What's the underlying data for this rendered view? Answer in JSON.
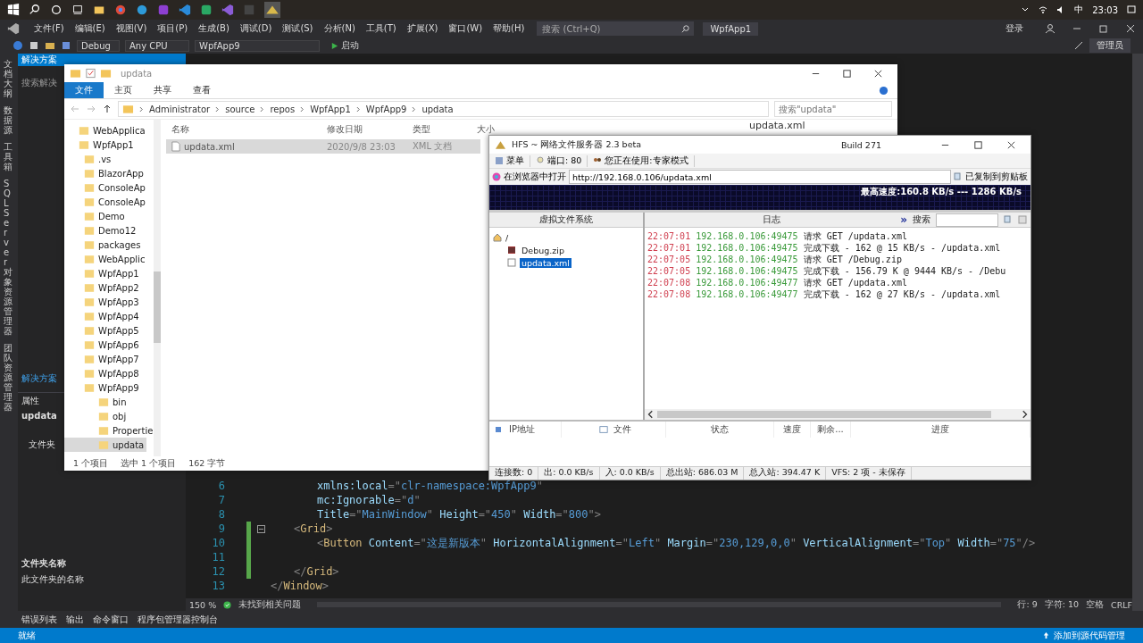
{
  "taskbar": {
    "ime": "中",
    "clock": "23:03"
  },
  "vs": {
    "menu": [
      "文件(F)",
      "编辑(E)",
      "视图(V)",
      "项目(P)",
      "生成(B)",
      "调试(D)",
      "测试(S)",
      "分析(N)",
      "工具(T)",
      "扩展(X)",
      "窗口(W)",
      "帮助(H)"
    ],
    "search": {
      "placeholder": "搜索 (Ctrl+Q)"
    },
    "solution_name": "WpfApp1",
    "login": "登录",
    "admin_badge": "管理员",
    "toolbar": {
      "configuration": "Debug",
      "platform": "Any CPU",
      "project": "WpfApp9",
      "start": "启动"
    },
    "side_tabs": [
      "文档大纲",
      "数据源",
      "工具箱",
      "SQL Server 对象资源管理器",
      "团队资源管理器"
    ],
    "solution_explorer": {
      "title": "解决方案",
      "search": "搜索解决",
      "footer_link": "解决方案"
    },
    "properties": {
      "title": "属性",
      "object": "updata",
      "row": "文件夹",
      "desc_title": "文件夹名称",
      "desc_text": "此文件夹的名称"
    },
    "code_lines": [
      {
        "number": "6",
        "changed": false,
        "foldable": false,
        "kind": "attribute",
        "tokens": [
          {
            "kind": "attr",
            "text": "xmlns:local"
          },
          {
            "kind": "punct",
            "text": "=\""
          },
          {
            "kind": "value",
            "text": "clr-namespace:WpfApp9"
          },
          {
            "kind": "punct",
            "text": "\""
          }
        ]
      },
      {
        "number": "7",
        "changed": false,
        "foldable": false,
        "kind": "attribute",
        "tokens": [
          {
            "kind": "attr",
            "text": "mc:Ignorable"
          },
          {
            "kind": "punct",
            "text": "=\""
          },
          {
            "kind": "value",
            "text": "d"
          },
          {
            "kind": "punct",
            "text": "\""
          }
        ]
      },
      {
        "number": "8",
        "changed": false,
        "foldable": false,
        "kind": "attribute",
        "tokens": [
          {
            "kind": "attr",
            "text": "Title"
          },
          {
            "kind": "punct",
            "text": "=\""
          },
          {
            "kind": "value",
            "text": "MainWindow"
          },
          {
            "kind": "punct",
            "text": "\" "
          },
          {
            "kind": "attr",
            "text": "Height"
          },
          {
            "kind": "punct",
            "text": "=\""
          },
          {
            "kind": "value",
            "text": "450"
          },
          {
            "kind": "punct",
            "text": "\" "
          },
          {
            "kind": "attr",
            "text": "Width"
          },
          {
            "kind": "punct",
            "text": "=\""
          },
          {
            "kind": "value",
            "text": "800"
          },
          {
            "kind": "punct",
            "text": "\">"
          }
        ]
      },
      {
        "number": "9",
        "changed": true,
        "foldable": true,
        "kind": "block",
        "tokens": [
          {
            "kind": "punct",
            "text": "<"
          },
          {
            "kind": "element",
            "text": "Grid"
          },
          {
            "kind": "punct",
            "text": ">"
          }
        ]
      },
      {
        "number": "10",
        "changed": true,
        "foldable": false,
        "kind": "nested",
        "tokens": [
          {
            "kind": "punct",
            "text": "<"
          },
          {
            "kind": "element",
            "text": "Button"
          },
          {
            "kind": "attr",
            "text": " Content"
          },
          {
            "kind": "punct",
            "text": "=\""
          },
          {
            "kind": "value",
            "text": "这是新版本"
          },
          {
            "kind": "punct",
            "text": "\" "
          },
          {
            "kind": "attr",
            "text": "HorizontalAlignment"
          },
          {
            "kind": "punct",
            "text": "=\""
          },
          {
            "kind": "value",
            "text": "Left"
          },
          {
            "kind": "punct",
            "text": "\" "
          },
          {
            "kind": "attr",
            "text": "Margin"
          },
          {
            "kind": "punct",
            "text": "=\""
          },
          {
            "kind": "value",
            "text": "230,129,0,0"
          },
          {
            "kind": "punct",
            "text": "\" "
          },
          {
            "kind": "attr",
            "text": "VerticalAlignment"
          },
          {
            "kind": "punct",
            "text": "=\""
          },
          {
            "kind": "value",
            "text": "Top"
          },
          {
            "kind": "punct",
            "text": "\" "
          },
          {
            "kind": "attr",
            "text": "Width"
          },
          {
            "kind": "punct",
            "text": "=\""
          },
          {
            "kind": "value",
            "text": "75"
          },
          {
            "kind": "punct",
            "text": "\"/>"
          }
        ]
      },
      {
        "number": "11",
        "changed": true,
        "foldable": false
      },
      {
        "number": "12",
        "changed": true,
        "foldable": false,
        "kind": "block",
        "tokens": [
          {
            "kind": "punct",
            "text": "</"
          },
          {
            "kind": "element",
            "text": "Grid"
          },
          {
            "kind": "punct",
            "text": ">"
          }
        ]
      },
      {
        "number": "13",
        "changed": false,
        "foldable": false,
        "kind": "root",
        "tokens": [
          {
            "kind": "punct",
            "text": "</"
          },
          {
            "kind": "element",
            "text": "Window"
          },
          {
            "kind": "punct",
            "text": ">"
          }
        ]
      }
    ],
    "editor_status": {
      "zoom": "150 %",
      "issues": "未找到相关问题",
      "line": "行: 9",
      "char": "字符: 10",
      "spaces": "空格",
      "eol": "CRLF"
    },
    "tool_tabs": [
      "错误列表",
      "输出",
      "命令窗口",
      "程序包管理器控制台"
    ],
    "status": {
      "text": "就绪",
      "source_control": "添加到源代码管理"
    }
  },
  "explorer": {
    "title": "updata",
    "ribbon_tabs": [
      {
        "label": "文件",
        "selected": true
      },
      {
        "label": "主页",
        "selected": false
      },
      {
        "label": "共享",
        "selected": false
      },
      {
        "label": "查看",
        "selected": false
      }
    ],
    "path": [
      "Administrator",
      "source",
      "repos",
      "WpfApp1",
      "WpfApp9",
      "updata"
    ],
    "search": {
      "placeholder": "搜索\"updata\""
    },
    "tree": [
      {
        "label": "WebApplica",
        "selected": false
      },
      {
        "label": "WpfApp1",
        "selected": false,
        "children": [
          {
            "label": ".vs",
            "selected": false
          },
          {
            "label": "BlazorApp",
            "selected": false
          },
          {
            "label": "ConsoleAp",
            "selected": false
          },
          {
            "label": "ConsoleAp",
            "selected": false
          },
          {
            "label": "Demo",
            "selected": false
          },
          {
            "label": "Demo12",
            "selected": false
          },
          {
            "label": "packages",
            "selected": false
          },
          {
            "label": "WebApplic",
            "selected": false
          },
          {
            "label": "WpfApp1",
            "selected": false
          },
          {
            "label": "WpfApp2",
            "selected": false
          },
          {
            "label": "WpfApp3",
            "selected": false
          },
          {
            "label": "WpfApp4",
            "selected": false
          },
          {
            "label": "WpfApp5",
            "selected": false
          },
          {
            "label": "WpfApp6",
            "selected": false
          },
          {
            "label": "WpfApp7",
            "selected": false
          },
          {
            "label": "WpfApp8",
            "selected": false
          },
          {
            "label": "WpfApp9",
            "selected": false,
            "children": [
              {
                "label": "bin",
                "selected": false
              },
              {
                "label": "obj",
                "selected": false
              },
              {
                "label": "Propertie",
                "selected": false
              },
              {
                "label": "updata",
                "selected": true
              }
            ]
          }
        ]
      }
    ],
    "columns": [
      "名称",
      "修改日期",
      "类型",
      "大小"
    ],
    "files": [
      {
        "name": "updata.xml",
        "modified": "2020/9/8 23:03",
        "type": "XML 文档",
        "selected": true
      }
    ],
    "preview_title": "updata.xml",
    "status": {
      "count": "1 个项目",
      "selection": "选中 1 个项目",
      "size": "162 字节"
    }
  },
  "hfs": {
    "title": "HFS ~ 网络文件服务器 2.3 beta",
    "build": "Build 271",
    "menu": "菜单",
    "port": "端口: 80",
    "mode": "您正在使用:专家模式",
    "open_browser": "在浏览器中打开",
    "url": "http://192.168.0.106/updata.xml",
    "copied": "已复制到剪贴板",
    "graph_label": "最高速度:160.8 KB/s --- 1286 KB/s",
    "vfs_title": "虚拟文件系统",
    "vfs_root": "/",
    "vfs_files": [
      {
        "name": "Debug.zip",
        "kind": "archive",
        "selected": false
      },
      {
        "name": "updata.xml",
        "kind": "document",
        "selected": true
      }
    ],
    "log_title": "日志",
    "log_expand": "»",
    "search_label": "搜索",
    "log": [
      {
        "time": "22:07:01",
        "address": "192.168.0.106:49475",
        "message": "请求 GET /updata.xml"
      },
      {
        "time": "22:07:01",
        "address": "192.168.0.106:49475",
        "message": "完成下载 - 162 @ 15 KB/s - /updata.xml"
      },
      {
        "time": "22:07:05",
        "address": "192.168.0.106:49475",
        "message": "请求 GET /Debug.zip"
      },
      {
        "time": "22:07:05",
        "address": "192.168.0.106:49475",
        "message": "完成下载 - 156.79 K @ 9444 KB/s - /Debu"
      },
      {
        "time": "22:07:08",
        "address": "192.168.0.106:49477",
        "message": "请求 GET /updata.xml"
      },
      {
        "time": "22:07:08",
        "address": "192.168.0.106:49477",
        "message": "完成下载 - 162 @ 27 KB/s - /updata.xml"
      }
    ],
    "conn_columns": [
      "IP地址",
      "文件",
      "状态",
      "速度",
      "剩余...",
      "进度"
    ],
    "status": [
      "连接数: 0",
      "出: 0.0 KB/s",
      "入: 0.0 KB/s",
      "总出站: 686.03 M",
      "总入站: 394.47 K",
      "VFS: 2 项 - 未保存"
    ]
  }
}
